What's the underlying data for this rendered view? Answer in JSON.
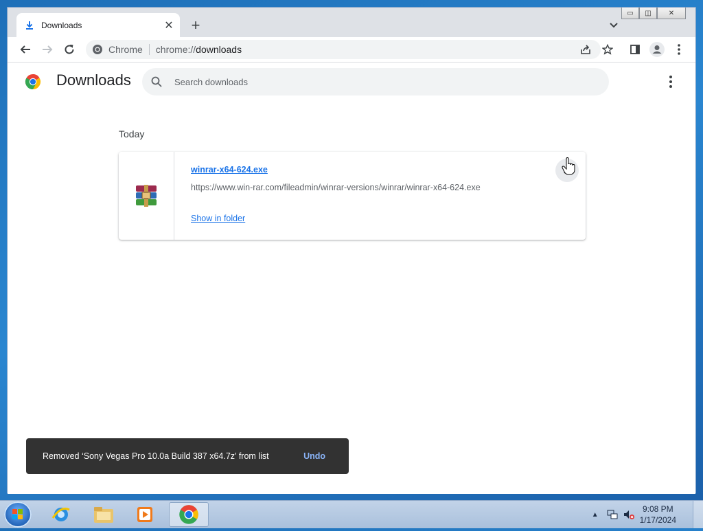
{
  "browser": {
    "tab": {
      "title": "Downloads",
      "close_glyph": "✕"
    },
    "new_tab_glyph": "+",
    "window_controls": {
      "minimize": "▭",
      "maximize": "◫",
      "close": "✕"
    },
    "omnibox": {
      "site_name": "Chrome",
      "url_scheme": "chrome://",
      "url_path": "downloads"
    }
  },
  "downloads_page": {
    "title": "Downloads",
    "search_placeholder": "Search downloads",
    "section": "Today",
    "items": [
      {
        "file_name": "winrar-x64-624.exe",
        "url": "https://www.win-rar.com/fileadmin/winrar-versions/winrar/winrar-x64-624.exe",
        "action": "Show in folder"
      }
    ]
  },
  "toast": {
    "message": "Removed ‘Sony Vegas Pro 10.0a Build 387 x64.7z’ from list",
    "undo": "Undo"
  },
  "taskbar": {
    "time": "9:08 PM",
    "date": "1/17/2024",
    "apps": [
      "internet-explorer",
      "file-explorer",
      "media-player",
      "chrome"
    ]
  },
  "colors": {
    "link": "#1a73e8",
    "toast_bg": "#323232",
    "undo": "#8ab4f8"
  }
}
